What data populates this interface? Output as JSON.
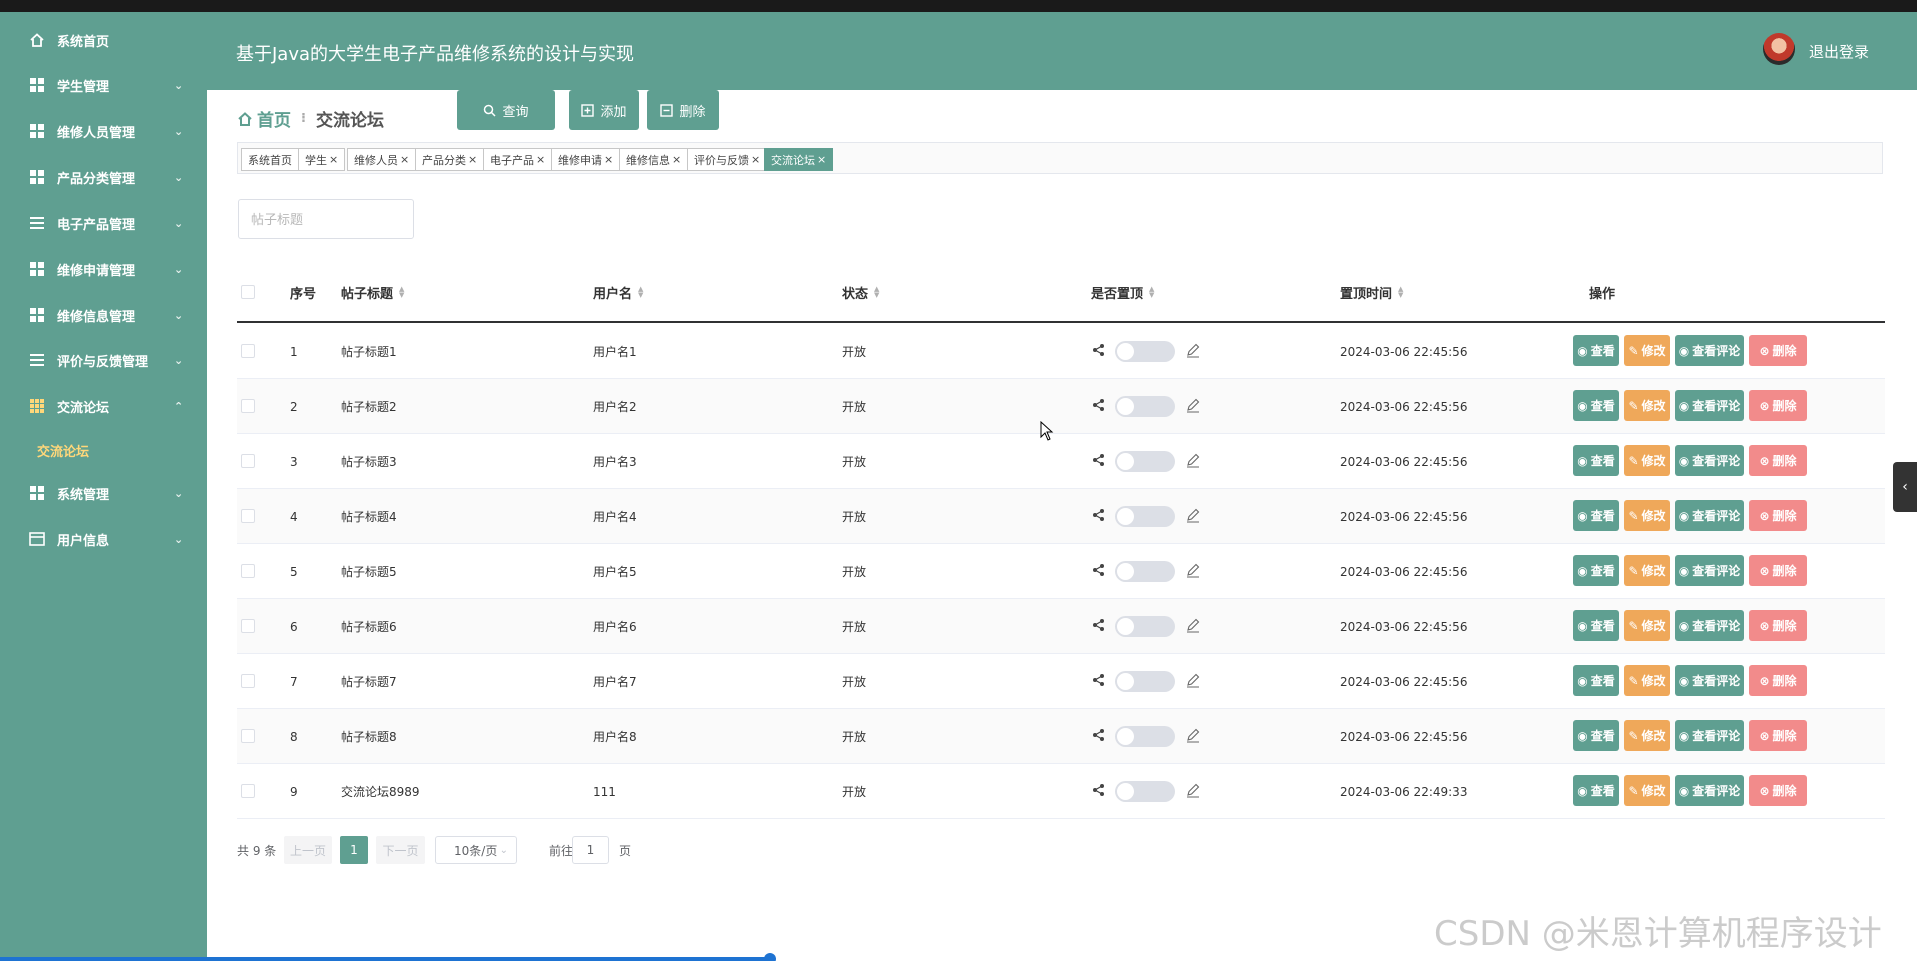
{
  "app": {
    "title": "基于Java的大学生电子产品维修系统的设计与实现",
    "logout": "退出登录"
  },
  "sidebar": {
    "items": [
      {
        "label": "系统首页",
        "icon": "home-icon",
        "expand": ""
      },
      {
        "label": "学生管理",
        "icon": "grid-icon",
        "expand": "⌄"
      },
      {
        "label": "维修人员管理",
        "icon": "grid-icon",
        "expand": "⌄"
      },
      {
        "label": "产品分类管理",
        "icon": "grid-icon",
        "expand": "⌄"
      },
      {
        "label": "电子产品管理",
        "icon": "list-icon",
        "expand": "⌄"
      },
      {
        "label": "维修申请管理",
        "icon": "grid-icon",
        "expand": "⌄"
      },
      {
        "label": "维修信息管理",
        "icon": "grid-icon",
        "expand": "⌄"
      },
      {
        "label": "评价与反馈管理",
        "icon": "list-icon",
        "expand": "⌄"
      },
      {
        "label": "交流论坛",
        "icon": "grid9-icon",
        "expand": "⌃"
      },
      {
        "label": "交流论坛",
        "icon": "",
        "expand": ""
      },
      {
        "label": "系统管理",
        "icon": "grid-icon",
        "expand": "⌄"
      },
      {
        "label": "用户信息",
        "icon": "card-icon",
        "expand": "⌄"
      }
    ]
  },
  "breadcrumb": {
    "home": "首页",
    "separator": "⁝",
    "current": "交流论坛"
  },
  "tags": [
    {
      "label": "系统首页",
      "close": ""
    },
    {
      "label": "学生",
      "close": "×"
    },
    {
      "label": "维修人员",
      "close": "×"
    },
    {
      "label": "产品分类",
      "close": "×"
    },
    {
      "label": "电子产品",
      "close": "×"
    },
    {
      "label": "维修申请",
      "close": "×"
    },
    {
      "label": "维修信息",
      "close": "×"
    },
    {
      "label": "评价与反馈",
      "close": "×"
    },
    {
      "label": "交流论坛",
      "close": "×"
    }
  ],
  "toolbar": {
    "search_placeholder": "帖子标题",
    "query": "查询",
    "add": "添加",
    "delete": "删除"
  },
  "table": {
    "headers": [
      "序号",
      "帖子标题",
      "用户名",
      "状态",
      "是否置顶",
      "置顶时间",
      "操作"
    ],
    "actions": {
      "view": "查看",
      "edit": "修改",
      "comments": "查看评论",
      "delete": "删除"
    },
    "rows": [
      {
        "no": "1",
        "title": "帖子标题1",
        "user": "用户名1",
        "status": "开放",
        "pinned": false,
        "time": "2024-03-06 22:45:56"
      },
      {
        "no": "2",
        "title": "帖子标题2",
        "user": "用户名2",
        "status": "开放",
        "pinned": false,
        "time": "2024-03-06 22:45:56"
      },
      {
        "no": "3",
        "title": "帖子标题3",
        "user": "用户名3",
        "status": "开放",
        "pinned": false,
        "time": "2024-03-06 22:45:56"
      },
      {
        "no": "4",
        "title": "帖子标题4",
        "user": "用户名4",
        "status": "开放",
        "pinned": false,
        "time": "2024-03-06 22:45:56"
      },
      {
        "no": "5",
        "title": "帖子标题5",
        "user": "用户名5",
        "status": "开放",
        "pinned": false,
        "time": "2024-03-06 22:45:56"
      },
      {
        "no": "6",
        "title": "帖子标题6",
        "user": "用户名6",
        "status": "开放",
        "pinned": false,
        "time": "2024-03-06 22:45:56"
      },
      {
        "no": "7",
        "title": "帖子标题7",
        "user": "用户名7",
        "status": "开放",
        "pinned": false,
        "time": "2024-03-06 22:45:56"
      },
      {
        "no": "8",
        "title": "帖子标题8",
        "user": "用户名8",
        "status": "开放",
        "pinned": false,
        "time": "2024-03-06 22:45:56"
      },
      {
        "no": "9",
        "title": "交流论坛8989",
        "user": "111",
        "status": "开放",
        "pinned": false,
        "time": "2024-03-06 22:49:33"
      }
    ]
  },
  "pagination": {
    "total": "共 9 条",
    "prev": "上一页",
    "page": "1",
    "next": "下一页",
    "page_size": "10条/页",
    "goto_prefix": "前往",
    "goto_value": "1",
    "goto_suffix": "页"
  },
  "watermark": "CSDN @米恩计算机程序设计",
  "colors": {
    "primary": "#5f9f91",
    "warning": "#efa85a",
    "danger": "#f28b8b",
    "active_sub": "#ffd77a"
  }
}
